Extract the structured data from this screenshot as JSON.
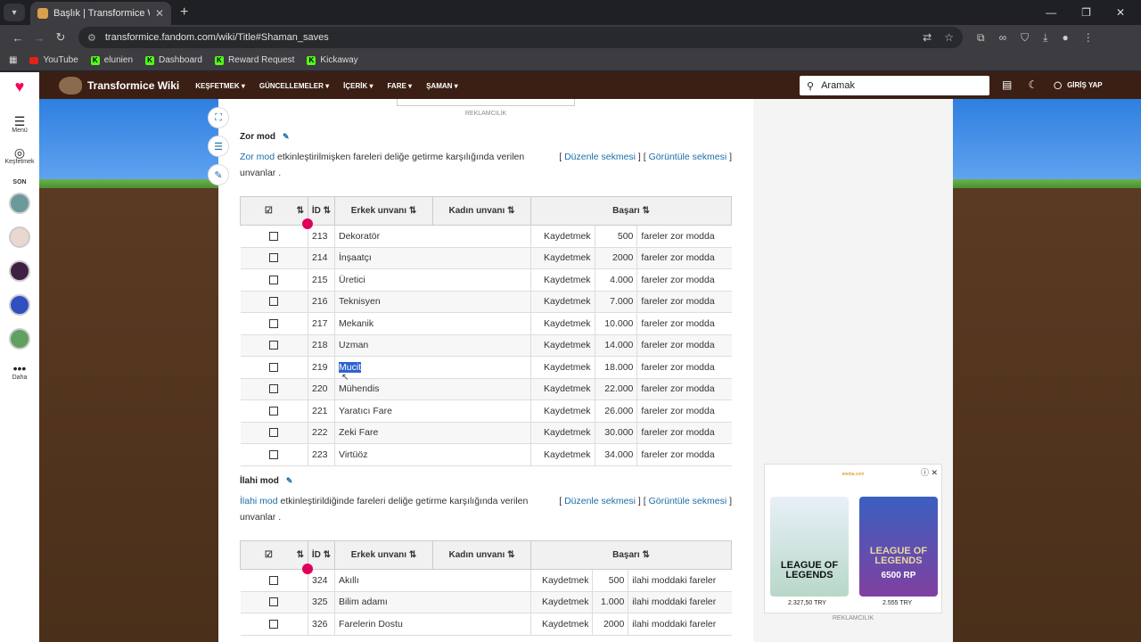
{
  "browser": {
    "tab_title": "Başlık | Transformice Wiki | Fan",
    "url": "transformice.fandom.com/wiki/Title#Shaman_saves",
    "bookmarks": [
      "YouTube",
      "elunien",
      "Dashboard",
      "Reward Request",
      "Kickaway"
    ]
  },
  "sidebar": {
    "menu_label": "Menü",
    "explore_label": "Keşfetmek",
    "recent_label": "SON",
    "more_label": "Daha"
  },
  "topnav": {
    "wiki_name": "Transformice Wiki",
    "menus": [
      "KEŞFETMEK",
      "GÜNCELLEMELER",
      "İÇERİK",
      "FARE",
      "ŞAMAN"
    ],
    "search_placeholder": "Aramak",
    "login": "GİRİŞ YAP"
  },
  "ad_label": "REKLAMCILIK",
  "hard": {
    "heading": "Zor mod",
    "link": "Zor mod",
    "text": " etkinleştirilmişken fareleri deliğe getirme karşılığında verilen",
    "text2": "unvanlar .",
    "edit_source": "Düzenle sekmesi",
    "view_source": "Görüntüle sekmesi",
    "headers": {
      "id": "İD",
      "male": "Erkek unvanı",
      "female": "Kadın unvanı",
      "achievement": "Başarı"
    },
    "rows": [
      {
        "id": "213",
        "name": "Dekoratör",
        "verb": "Kaydetmek",
        "num": "500",
        "desc": "fareler zor modda"
      },
      {
        "id": "214",
        "name": "İnşaatçı",
        "verb": "Kaydetmek",
        "num": "2000",
        "desc": "fareler zor modda"
      },
      {
        "id": "215",
        "name": "Üretici",
        "verb": "Kaydetmek",
        "num": "4.000",
        "desc": "fareler zor modda"
      },
      {
        "id": "216",
        "name": "Teknisyen",
        "verb": "Kaydetmek",
        "num": "7.000",
        "desc": "fareler zor modda"
      },
      {
        "id": "217",
        "name": "Mekanik",
        "verb": "Kaydetmek",
        "num": "10.000",
        "desc": "fareler zor modda"
      },
      {
        "id": "218",
        "name": "Uzman",
        "verb": "Kaydetmek",
        "num": "14.000",
        "desc": "fareler zor modda"
      },
      {
        "id": "219",
        "name": "Mucit",
        "verb": "Kaydetmek",
        "num": "18.000",
        "desc": "fareler zor modda"
      },
      {
        "id": "220",
        "name": "Mühendis",
        "verb": "Kaydetmek",
        "num": "22.000",
        "desc": "fareler zor modda"
      },
      {
        "id": "221",
        "name": "Yaratıcı Fare",
        "verb": "Kaydetmek",
        "num": "26.000",
        "desc": "fareler zor modda"
      },
      {
        "id": "222",
        "name": "Zeki Fare",
        "verb": "Kaydetmek",
        "num": "30.000",
        "desc": "fareler zor modda"
      },
      {
        "id": "223",
        "name": "Virtüöz",
        "verb": "Kaydetmek",
        "num": "34.000",
        "desc": "fareler zor modda"
      }
    ]
  },
  "divine": {
    "heading": "İlahi mod",
    "link": "İlahi mod",
    "text": " etkinleştirildiğinde fareleri deliğe getirme karşılığında verilen",
    "text2": "unvanlar .",
    "edit_source": "Düzenle sekmesi",
    "view_source": "Görüntüle sekmesi",
    "headers": {
      "id": "İD",
      "male": "Erkek unvanı",
      "female": "Kadın unvanı",
      "achievement": "Başarı"
    },
    "rows": [
      {
        "id": "324",
        "name": "Akıllı",
        "verb": "Kaydetmek",
        "num": "500",
        "desc": "ilahi moddaki fareler"
      },
      {
        "id": "325",
        "name": "Bilim adamı",
        "verb": "Kaydetmek",
        "num": "1.000",
        "desc": "ilahi moddaki fareler"
      },
      {
        "id": "326",
        "name": "Farelerin Dostu",
        "verb": "Kaydetmek",
        "num": "2000",
        "desc": "ilahi moddaki fareler"
      }
    ]
  },
  "ad_right": {
    "source": "eneba.com",
    "game": "LEAGUE OF LEGENDS",
    "rp": "6500 RP",
    "price1": "2.327,50 TRY",
    "price2": "2.555 TRY"
  }
}
